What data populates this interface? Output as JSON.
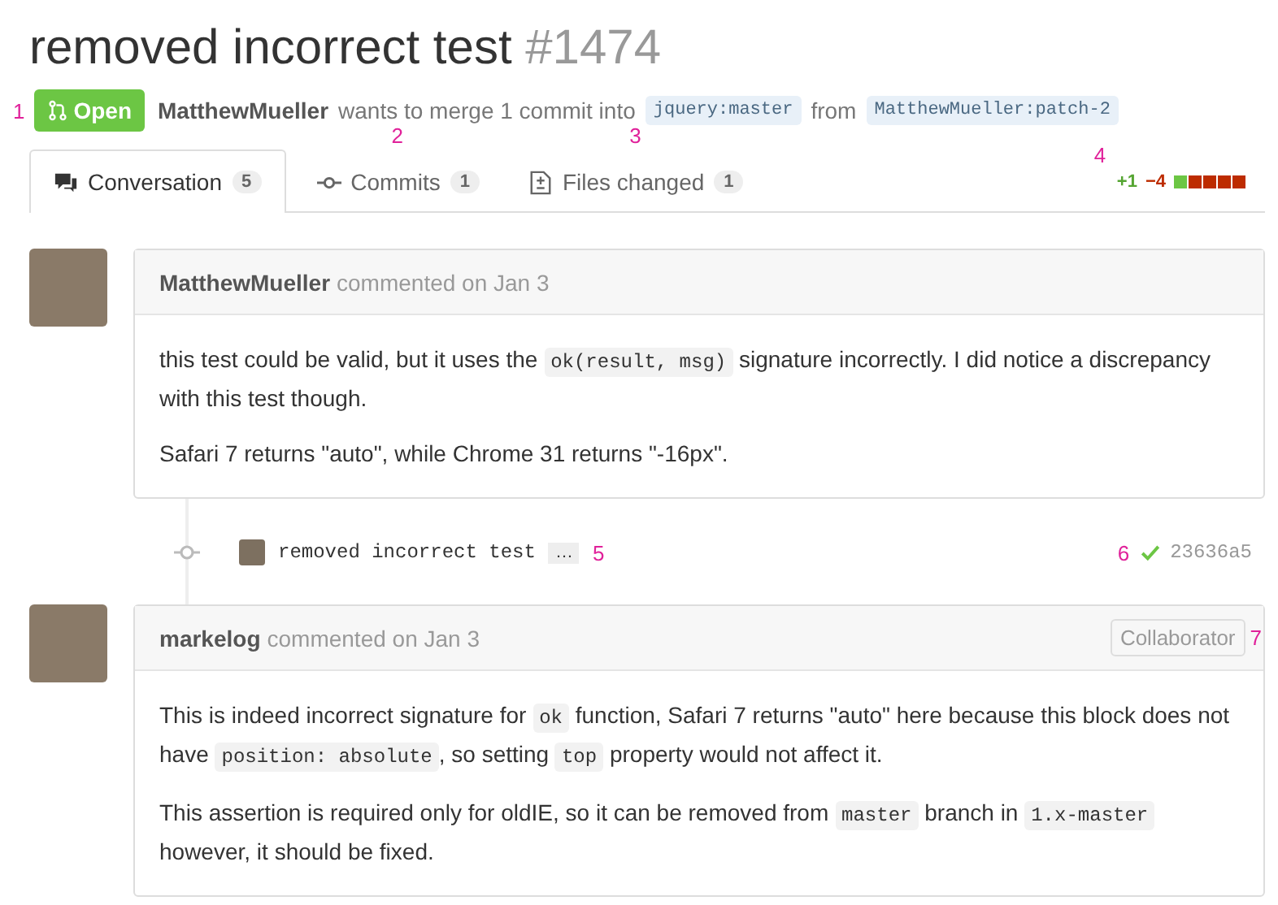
{
  "title": "removed incorrect test",
  "number": "#1474",
  "state": {
    "label": "Open",
    "marker": "1"
  },
  "merge_info": {
    "author": "MatthewMueller",
    "text": "wants to merge 1 commit into",
    "base": "jquery:master",
    "from": "from",
    "head": "MatthewMueller:patch-2"
  },
  "tabs": [
    {
      "label": "Conversation",
      "count": "5",
      "selected": true
    },
    {
      "label": "Commits",
      "count": "1",
      "selected": false,
      "marker": "2"
    },
    {
      "label": "Files changed",
      "count": "1",
      "selected": false,
      "marker": "3"
    }
  ],
  "diffstat": {
    "marker": "4",
    "additions": "+1",
    "deletions": "−4"
  },
  "timeline": [
    {
      "kind": "comment",
      "author": "MatthewMueller",
      "meta": "commented on Jan 3",
      "paragraphs": [
        [
          {
            "kind": "text",
            "text": "this test could be valid, but it uses the "
          },
          {
            "kind": "code",
            "text": "ok(result, msg)"
          },
          {
            "kind": "text",
            "text": " signature incorrectly. I did notice a discrepancy with this test though."
          }
        ],
        [
          {
            "kind": "text",
            "text": "Safari 7 returns \"auto\", while Chrome 31 returns \"-16px\"."
          }
        ]
      ]
    },
    {
      "kind": "commit",
      "message": "removed incorrect test",
      "ellipsis": "…",
      "marker": "5",
      "status_marker": "6",
      "sha": "23636a5"
    },
    {
      "kind": "comment",
      "author": "markelog",
      "meta": "commented on Jan 3",
      "role": "Collaborator",
      "role_marker": "7",
      "paragraphs": [
        [
          {
            "kind": "text",
            "text": "This is indeed incorrect signature for "
          },
          {
            "kind": "code",
            "text": "ok"
          },
          {
            "kind": "text",
            "text": " function, Safari 7 returns \"auto\" here because this block does not have "
          },
          {
            "kind": "code",
            "text": "position: absolute"
          },
          {
            "kind": "text",
            "text": ", so setting "
          },
          {
            "kind": "code",
            "text": "top"
          },
          {
            "kind": "text",
            "text": " property would not affect it."
          }
        ],
        [
          {
            "kind": "text",
            "text": "This assertion is required only for oldIE, so it can be removed from "
          },
          {
            "kind": "code",
            "text": "master"
          },
          {
            "kind": "text",
            "text": " branch in "
          },
          {
            "kind": "code",
            "text": "1.x-master"
          },
          {
            "kind": "text",
            "text": " however, it should be fixed."
          }
        ]
      ]
    }
  ]
}
